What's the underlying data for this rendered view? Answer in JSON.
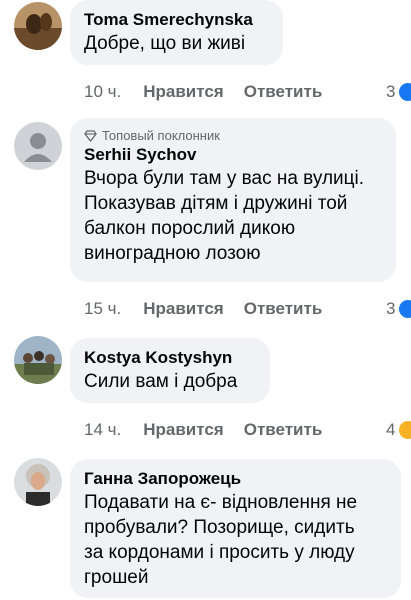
{
  "comments": [
    {
      "author": "Toma Smerechynska",
      "badge": "",
      "lines": [
        "Добре, що ви живі"
      ],
      "time": "10 ч.",
      "like_label": "Нравится",
      "reply_label": "Ответить",
      "reactions": "3"
    },
    {
      "author": "Serhii Sychov",
      "badge": "Топовый поклонник",
      "lines": [
        "Вчора були там у вас на вулиці.",
        "Показував дітям і дружині той",
        "балкон порослий дикою",
        "виноградною лозою"
      ],
      "time": "15 ч.",
      "like_label": "Нравится",
      "reply_label": "Ответить",
      "reactions": "3"
    },
    {
      "author": "Kostya Kostyshyn",
      "badge": "",
      "lines": [
        "Сили вам і добра"
      ],
      "time": "14 ч.",
      "like_label": "Нравится",
      "reply_label": "Ответить",
      "reactions": "4"
    },
    {
      "author": "Ганна Запорожець",
      "badge": "",
      "lines": [
        "Подавати на є- відновлення не",
        "пробували? Позорище, сидить",
        "за кордонами і просить у люду",
        "грошей"
      ]
    }
  ],
  "colors": {
    "bubble": "#f0f2f5",
    "secondary_text": "#65676b",
    "like_blue": "#1877f2"
  }
}
